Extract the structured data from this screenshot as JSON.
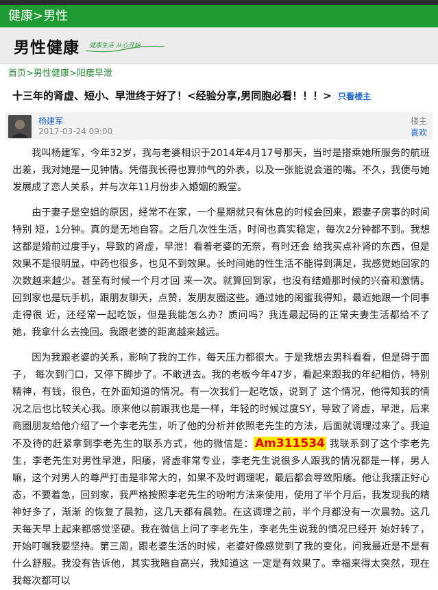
{
  "header": {
    "title": "健康>男性"
  },
  "subheader": {
    "title": "男性健康",
    "slogan": "健康生活 从心开始"
  },
  "breadcrumb": {
    "home": "首页",
    "sep1": ">",
    "cat": "男性健康",
    "sep2": ">",
    "sub": "阳痿早泄"
  },
  "article": {
    "title": "十三年的肾虚、短小、早泄终于好了！<经验分享,男同胞必看！！！>",
    "only_author": "只看楼主"
  },
  "post": {
    "author": "杨建军",
    "date": "2017-03-24 09:00",
    "floor": "楼主",
    "like": "喜欢"
  },
  "content": {
    "p1": "我叫杨建军，今年32岁，我与老婆相识于2014年4月17号那天，当时是搭乘她所服务的航班出差，我对她是一见钟情。凭借我长得也算帅气的外表，以及一张能说会道的嘴。不久，我便与她发展成了恋人关系，并与次年11月份步入婚姻的殿堂。",
    "p2": "由于妻子是空姐的原因，经常不在家，一个星期就只有休息的时候会回来，跟妻子房事的时间特别 短，1分钟。真的是无地自容。之后几次性生活，时间也真实稳定，每次2分钟都不到。我想这都是婚前过度手y，导致的肾虚，早泄！看着老婆的无奈，有时还会 给我买点补肾的东西，但是效果不是很明显，中药也很多，也见不到效果。长时间她的性生活不能得到满足，我感觉她回家的次数越来越少。甚至有时候一个月才回 来一次。就算回到家，也没有结婚那时候的兴奋和激情。回到家也是玩手机，跟朋友聊天，点赞，发朋友圈这些。通过她的闺蜜我得知，最近她跟一个同事走得很 近，还经常一起吃饭，但是我能怎么办？质问吗？我连最起码的正常夫妻生活都给不了她，我拿什么去挽回。我跟老婆的距离越来越远。",
    "p3a": "因为我跟老婆的关系，影响了我的工作，每天压力都很大。于是我想去男科看看，但是碍于面子， 每次到门口，又停下脚步了。不敢进去。我的老板今年47岁，看起来跟我的年纪相仿，特别精神，有钱，很色，在外面知道的情况。有一次我们一起吃饭，说到了 这个情况，他得知我的情况之后也比较关心我。原来他以前跟我也是一样，年轻的时候过度SY，导致了肾虚，早泄，后来商圈朋友给他介绍了一个李老先生，听了他的分析并依照老先生的方法，后面就调理过来了。我迫不及待的赶紧拿到李老先生的联系方式，他的微信是：",
    "wechat": "Am311534",
    "p3b": " 我联系到了这个李老先生，李老先生对男性早泄，阳痿，肾虚非常专业，李老先生说很多人跟我的情况都是一样，男人嘛，这个对男人的尊严打击是非常大的，如果不及时调理呢，最后都会导致阳痿。他让我摆正好心态，不要着急，回到家，我严格按照李老先生的吩咐方法来使用，使用了半个月后，我发现我的精神好多了，渐渐 的恢复了晨勃，这几天都有晨勃。在这调理之前，半个月都没有一次晨勃。这几天每天早上起来都感觉坚硬。我在微信上问了李老先生，李老先生说我的情况已经开 始好转了，开始叮嘱我要坚持。第三周，跟老婆生活的时候，老婆好像感觉到了我的变化，问我最近是不是有什么舒服。我没有告诉他，其实我暗自高兴，我知道这 一定是有效果了。幸福来得太突然，现在我每次都可以"
  },
  "colors": {
    "brand_green": "#1e9a33",
    "link_blue": "#1a64c8",
    "highlight_yellow": "#ffe800",
    "highlight_red": "#e60000"
  }
}
